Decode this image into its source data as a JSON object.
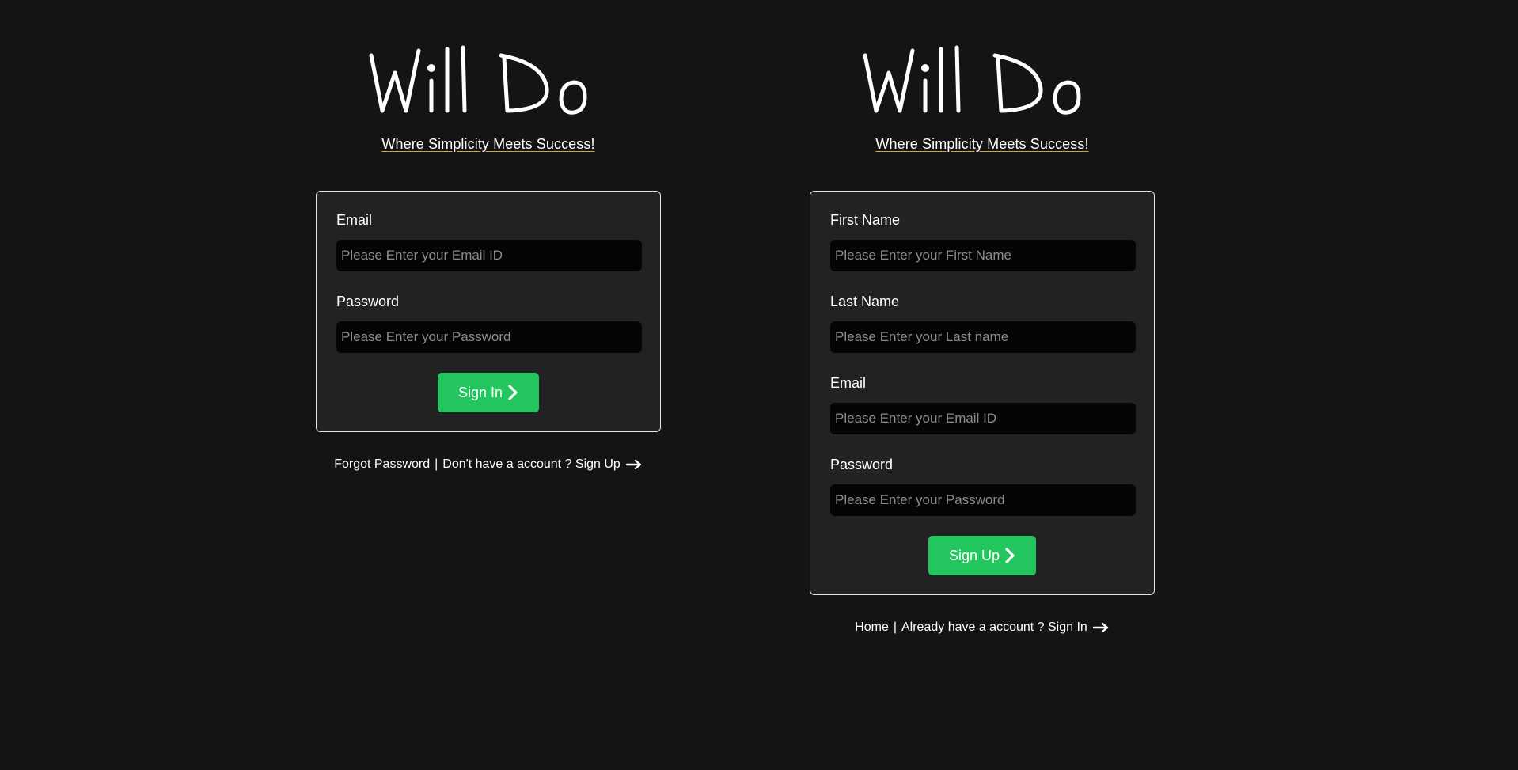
{
  "colors": {
    "background": "#141414",
    "card": "#222222",
    "input": "#050505",
    "accent_green": "#22c55e",
    "underline_gold": "#d9a23a"
  },
  "signin": {
    "logo_text": "Will Do",
    "tagline": "Where Simplicity Meets Success!",
    "fields": {
      "email_label": "Email",
      "email_placeholder": "Please Enter your Email ID",
      "password_label": "Password",
      "password_placeholder": "Please Enter your Password"
    },
    "button_label": "Sign In",
    "footer": {
      "forgot": "Forgot Password",
      "separator": "|",
      "prompt": "Don't have a account ? Sign Up"
    }
  },
  "signup": {
    "logo_text": "Will Do",
    "tagline": "Where Simplicity Meets Success!",
    "fields": {
      "first_name_label": "First Name",
      "first_name_placeholder": "Please Enter your First Name",
      "last_name_label": "Last Name",
      "last_name_placeholder": "Please Enter your Last name",
      "email_label": "Email",
      "email_placeholder": "Please Enter your Email ID",
      "password_label": "Password",
      "password_placeholder": "Please Enter your Password"
    },
    "button_label": "Sign Up",
    "footer": {
      "home": "Home",
      "separator": "|",
      "prompt": "Already have a account ? Sign In"
    }
  }
}
